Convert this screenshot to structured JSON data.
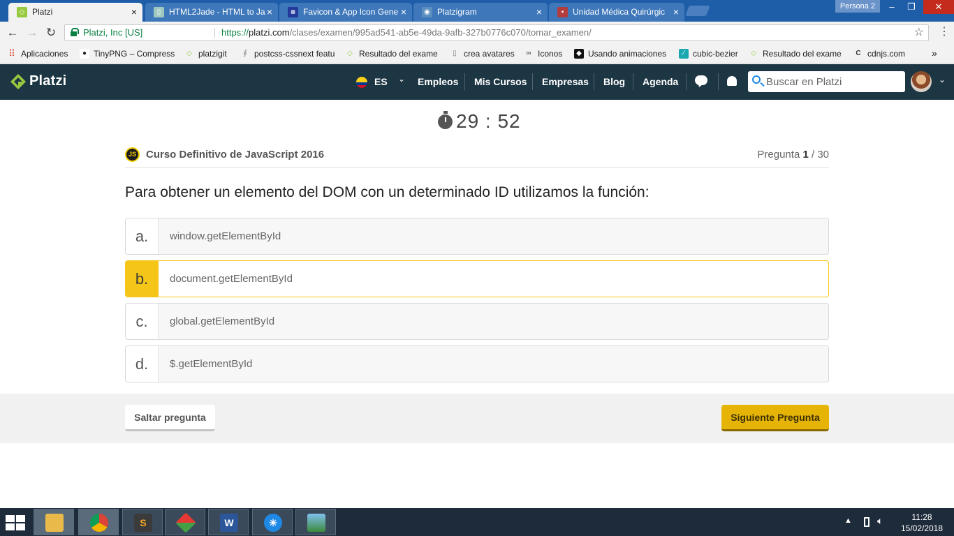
{
  "browser": {
    "tabs": [
      {
        "title": "Platzi",
        "favicon": "platzi-icon",
        "active": true
      },
      {
        "title": "HTML2Jade - HTML to Ja",
        "favicon": "html2jade-icon",
        "active": false
      },
      {
        "title": "Favicon & App Icon Gene",
        "favicon": "favicon-generator-icon",
        "active": false
      },
      {
        "title": "Platzigram",
        "favicon": "platzigram-icon",
        "active": false
      },
      {
        "title": "Unidad Médica Quirúrgic",
        "favicon": "medical-icon",
        "active": false
      }
    ],
    "profile": "Persona 2",
    "address": {
      "secure_label": "Platzi, Inc [US]",
      "url_scheme": "https://",
      "url_host": "platzi.com",
      "url_path": "/clases/examen/995ad541-ab5e-49da-9afb-327b0776c070/tomar_examen/"
    },
    "bookmarks": [
      {
        "label": "Aplicaciones",
        "icon": "apps-grid-icon"
      },
      {
        "label": "TinyPNG – Compress",
        "icon": "panda-icon"
      },
      {
        "label": "platzigit",
        "icon": "platzi-icon"
      },
      {
        "label": "postcss-cssnext featu",
        "icon": "postcss-icon"
      },
      {
        "label": "Resultado del exame",
        "icon": "platzi-icon"
      },
      {
        "label": "crea avatares",
        "icon": "page-icon"
      },
      {
        "label": "Iconos",
        "icon": "binoculars-icon"
      },
      {
        "label": "Usando animaciones",
        "icon": "mdn-icon"
      },
      {
        "label": "cubic-bezier",
        "icon": "bezier-icon"
      },
      {
        "label": "Resultado del exame",
        "icon": "platzi-icon"
      },
      {
        "label": "cdnjs.com",
        "icon": "cdnjs-icon"
      }
    ],
    "bookmarks_overflow": "»"
  },
  "header": {
    "logo_text": "Platzi",
    "language": "ES",
    "nav": [
      "Empleos",
      "Mis Cursos",
      "Empresas",
      "Blog",
      "Agenda"
    ],
    "search_placeholder": "Buscar en Platzi"
  },
  "exam": {
    "timer": "29 : 52",
    "course_badge": "JS",
    "course_title": "Curso Definitivo de JavaScript 2016",
    "question_label": "Pregunta",
    "question_current": "1",
    "question_total": " / 30",
    "question": "Para obtener un elemento del DOM con un determinado ID utilizamos la función:",
    "options": [
      {
        "letter": "a.",
        "text": "window.getElementById",
        "selected": false
      },
      {
        "letter": "b.",
        "text": "document.getElementById",
        "selected": true
      },
      {
        "letter": "c.",
        "text": "global.getElementById",
        "selected": false
      },
      {
        "letter": "d.",
        "text": "$.getElementById",
        "selected": false
      }
    ],
    "skip_label": "Saltar pregunta",
    "next_label": "Siguiente Pregunta"
  },
  "colors": {
    "header_bg": "#1c3643",
    "platzi_green": "#98ca3f",
    "selected_accent": "#f5c518",
    "next_button": "#e5b407"
  },
  "taskbar": {
    "apps": [
      "file-explorer-icon",
      "chrome-icon",
      "sublime-text-icon",
      "kite-icon",
      "word-icon",
      "brightness-icon",
      "photos-icon"
    ],
    "time": "11:28",
    "date": "15/02/2018"
  }
}
